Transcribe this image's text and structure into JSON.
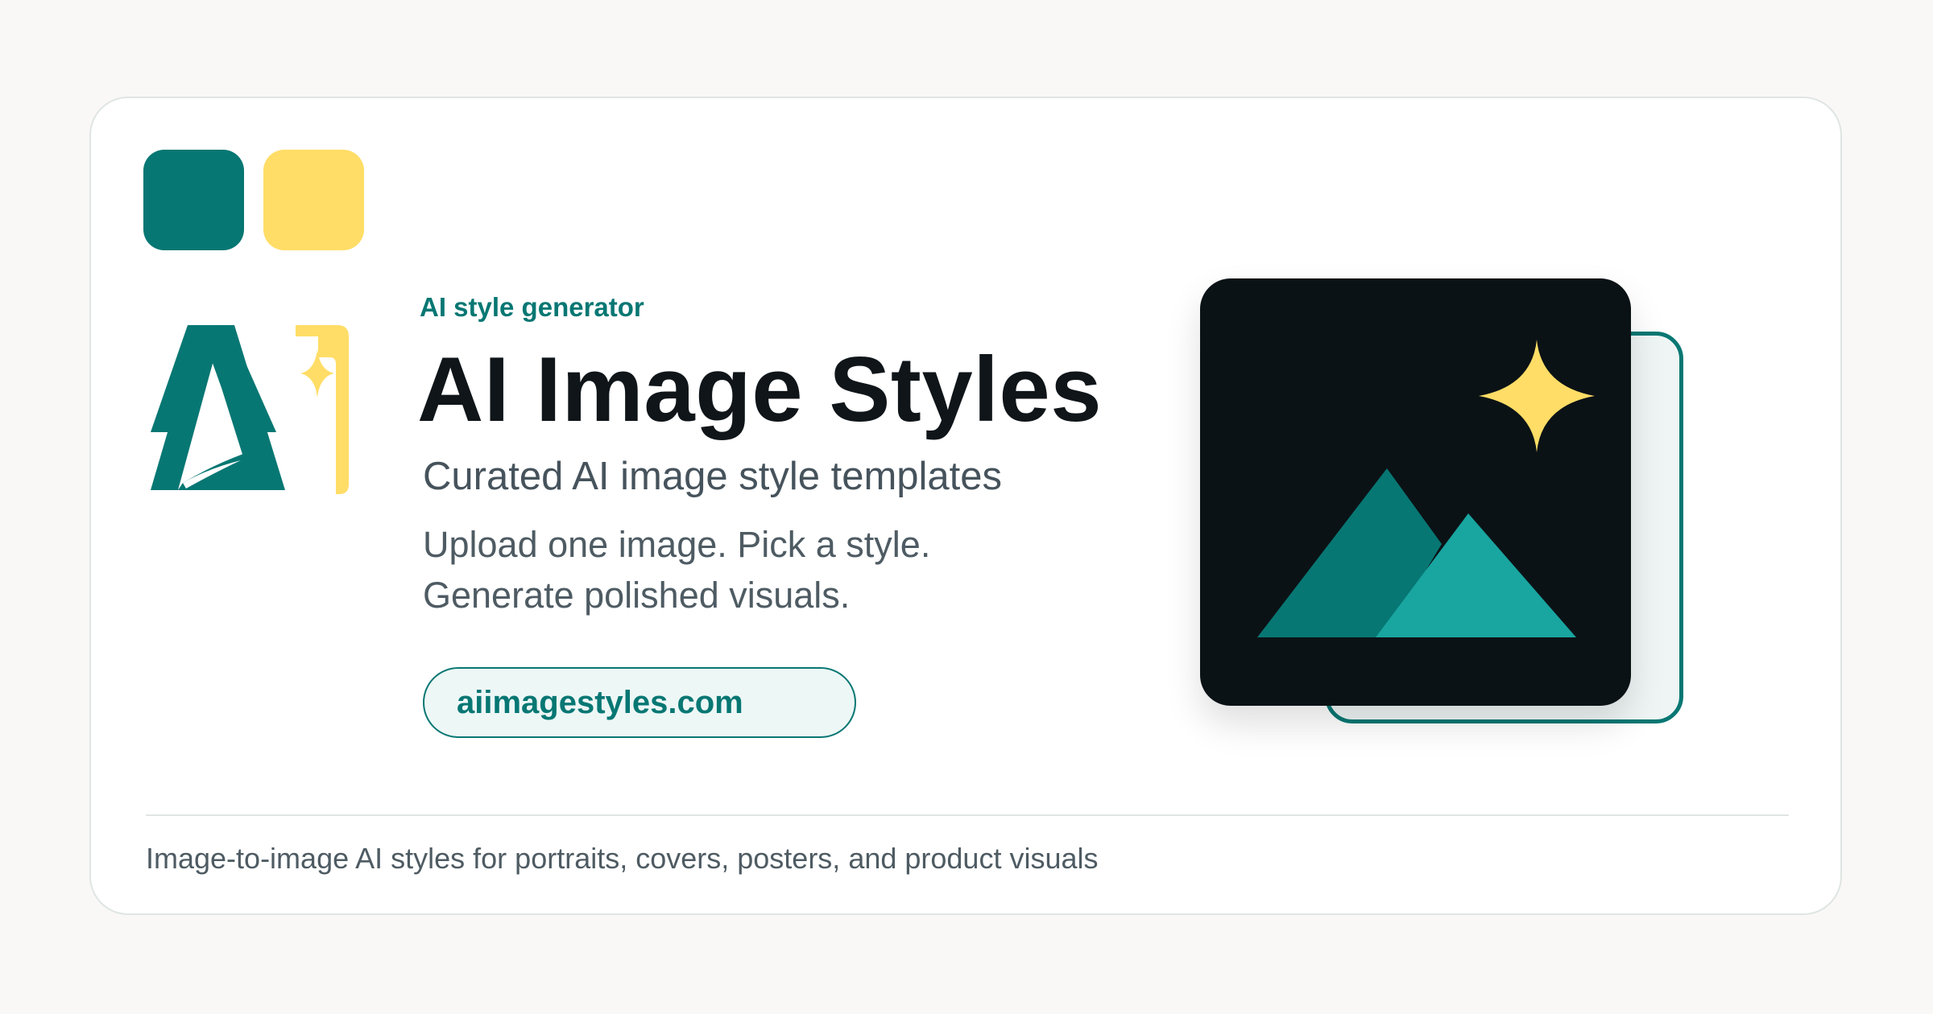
{
  "card": {
    "eyebrow": "AI style generator",
    "title": "AI Image Styles",
    "subtitle": "Curated AI image style templates",
    "description_lines": [
      "Upload one image. Pick a style.",
      "Generate polished visuals."
    ],
    "url": "aiimagestyles.com",
    "footer": "Image-to-image AI styles for portraits, covers, posters, and product visuals"
  },
  "icons": {
    "logo": "ai-logo-icon",
    "artwork": "image-sparkle-icon"
  },
  "colors": {
    "background": "#f9f8f6",
    "card": "#ffffff",
    "teal": "#077773",
    "teal_light": "#19a5a0",
    "yellow": "#ffdd66",
    "dark": "#0b1216",
    "title": "#0f1519",
    "text_muted": "#4e5b63"
  }
}
